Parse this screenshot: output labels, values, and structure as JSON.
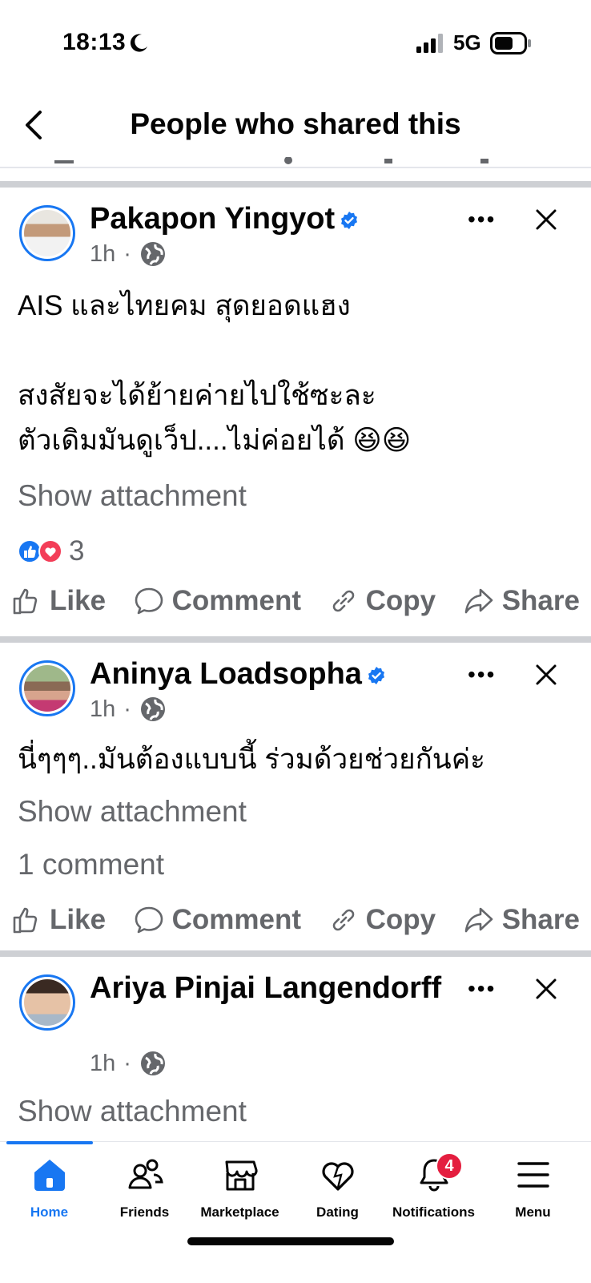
{
  "status_bar": {
    "time": "18:13",
    "network": "5G"
  },
  "header": {
    "title": "People who shared this"
  },
  "posts": [
    {
      "name": "Pakapon Yingyot",
      "time": "1h",
      "text": "AIS และไทยคม สุดยอดแฮง\n\nสงสัยจะได้ย้ายค่ายไปใช้ซะละ\nตัวเดิมมันดูเว็ป....ไม่ค่อยได้ 😆😆",
      "attachment": "Show attachment",
      "reactions": "3"
    },
    {
      "name": "Aninya Loadsopha",
      "time": "1h",
      "text": "นี่ๆๆๆ..มันต้องแบบนี้ ร่วมด้วยช่วยกันค่ะ",
      "attachment": "Show attachment",
      "comments": "1 comment"
    },
    {
      "name": "Ariya Pinjai Langendorff",
      "time": "1h",
      "attachment": "Show attachment"
    }
  ],
  "actions": {
    "like": "Like",
    "comment": "Comment",
    "copy": "Copy",
    "share": "Share"
  },
  "nav": {
    "items": [
      {
        "label": "Home",
        "icon": "home-icon"
      },
      {
        "label": "Friends",
        "icon": "friends-icon"
      },
      {
        "label": "Marketplace",
        "icon": "marketplace-icon"
      },
      {
        "label": "Dating",
        "icon": "dating-icon"
      },
      {
        "label": "Notifications",
        "icon": "bell-icon"
      },
      {
        "label": "Menu",
        "icon": "menu-icon"
      }
    ],
    "notifications_badge": "4"
  },
  "colors": {
    "accent": "#1877f2",
    "badge": "#e41e3f",
    "muted": "#65676b",
    "separator": "#ced0d4"
  }
}
